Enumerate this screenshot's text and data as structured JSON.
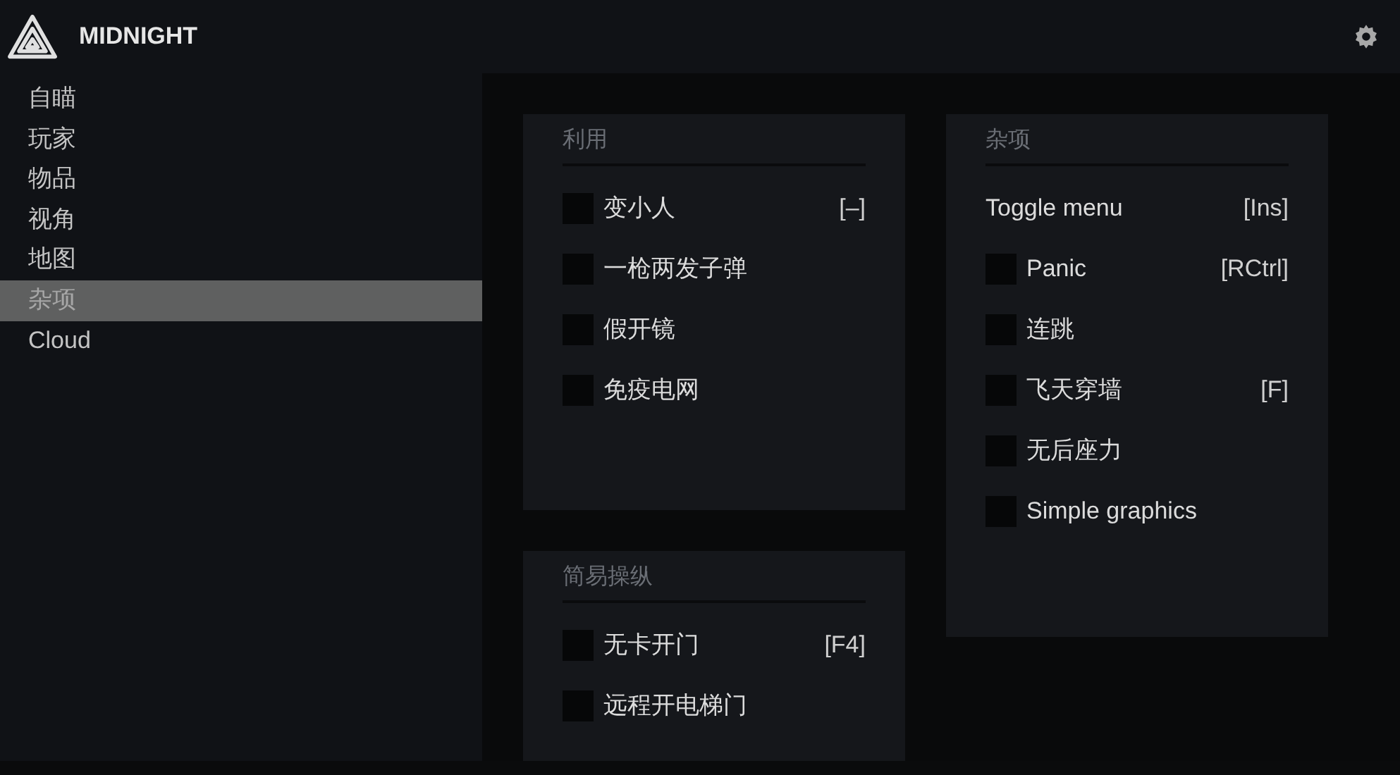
{
  "header": {
    "title": "MIDNIGHT"
  },
  "sidebar": {
    "items": [
      {
        "label": "自瞄",
        "selected": false
      },
      {
        "label": "玩家",
        "selected": false
      },
      {
        "label": "物品",
        "selected": false
      },
      {
        "label": "视角",
        "selected": false
      },
      {
        "label": "地图",
        "selected": false
      },
      {
        "label": "杂项",
        "selected": true
      },
      {
        "label": "Cloud",
        "selected": false
      }
    ]
  },
  "columns": [
    {
      "panels": [
        {
          "title": "利用",
          "rows": [
            {
              "kind": "checkbox",
              "label": "变小人",
              "checked": false,
              "hotkey": "[–]"
            },
            {
              "kind": "checkbox",
              "label": "一枪两发子弹",
              "checked": false
            },
            {
              "kind": "checkbox",
              "label": "假开镜",
              "checked": false
            },
            {
              "kind": "checkbox",
              "label": "免疫电网",
              "checked": false
            }
          ]
        },
        {
          "title": "简易操纵",
          "rows": [
            {
              "kind": "checkbox",
              "label": "无卡开门",
              "checked": false,
              "hotkey": "[F4]"
            },
            {
              "kind": "checkbox",
              "label": "远程开电梯门",
              "checked": false
            }
          ]
        }
      ]
    },
    {
      "panels": [
        {
          "title": "杂项",
          "rows": [
            {
              "kind": "keybind",
              "label": "Toggle menu",
              "hotkey": "[Ins]"
            },
            {
              "kind": "checkbox",
              "label": "Panic",
              "checked": false,
              "hotkey": "[RCtrl]"
            },
            {
              "kind": "checkbox",
              "label": "连跳",
              "checked": false
            },
            {
              "kind": "checkbox",
              "label": "飞天穿墙",
              "checked": false,
              "hotkey": "[F]"
            },
            {
              "kind": "checkbox",
              "label": "无后座力",
              "checked": false
            },
            {
              "kind": "checkbox",
              "label": "Simple graphics",
              "checked": false
            }
          ]
        }
      ]
    }
  ]
}
